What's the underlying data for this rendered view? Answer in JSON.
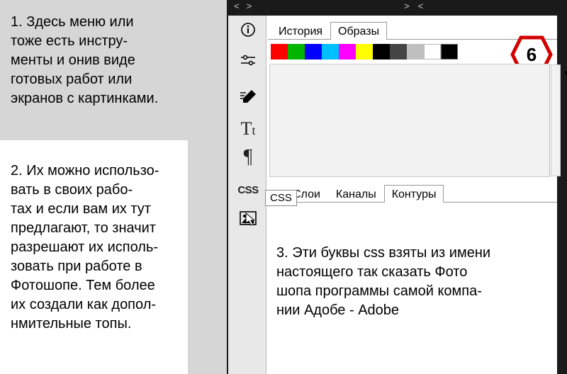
{
  "notes": {
    "n1": "1. Здесь меню или\n    тоже есть инстру-\nменты и онив виде\nготовых работ или\nэкранов с картинками.",
    "n2": "2. Их можно использо-\n    вать в своих рабо-\nтах и если вам их тут\nпредлагают, то значит\nразрешают их исполь-\nзовать при работе в\nФотошопе. Тем более\nих создали как допол-\nнмительные топы.",
    "n3": "3. Эти буквы css взяты из имени\n    настоящего так сказать Фото\nшопа программы самой компа-\nнии Адобе - Adobe"
  },
  "topbar": {
    "arrows_left": "< >",
    "arrows_right": ">  <"
  },
  "tool_icons": {
    "info": "info-icon",
    "sliders": "sliders-icon",
    "brush": "brush-icon",
    "text": "text-icon",
    "paragraph": "paragraph-icon",
    "css": "CSS",
    "image": "image-icon"
  },
  "panel_tabs": {
    "history": "История",
    "samples": "Образы"
  },
  "lower_tabs": {
    "layers": "Слои",
    "channels": "Каналы",
    "paths": "Контуры"
  },
  "tooltip": {
    "css": "CSS"
  },
  "badge": {
    "number": "6"
  },
  "swatches": [
    "#ff0000",
    "#00b400",
    "#0000ff",
    "#00bfff",
    "#ff00ff",
    "#ffff00",
    "#000000",
    "#444444",
    "#bfbfbf",
    "#ffffff",
    "#000000"
  ],
  "preview": {
    "dropdown_glyph": "▼"
  }
}
